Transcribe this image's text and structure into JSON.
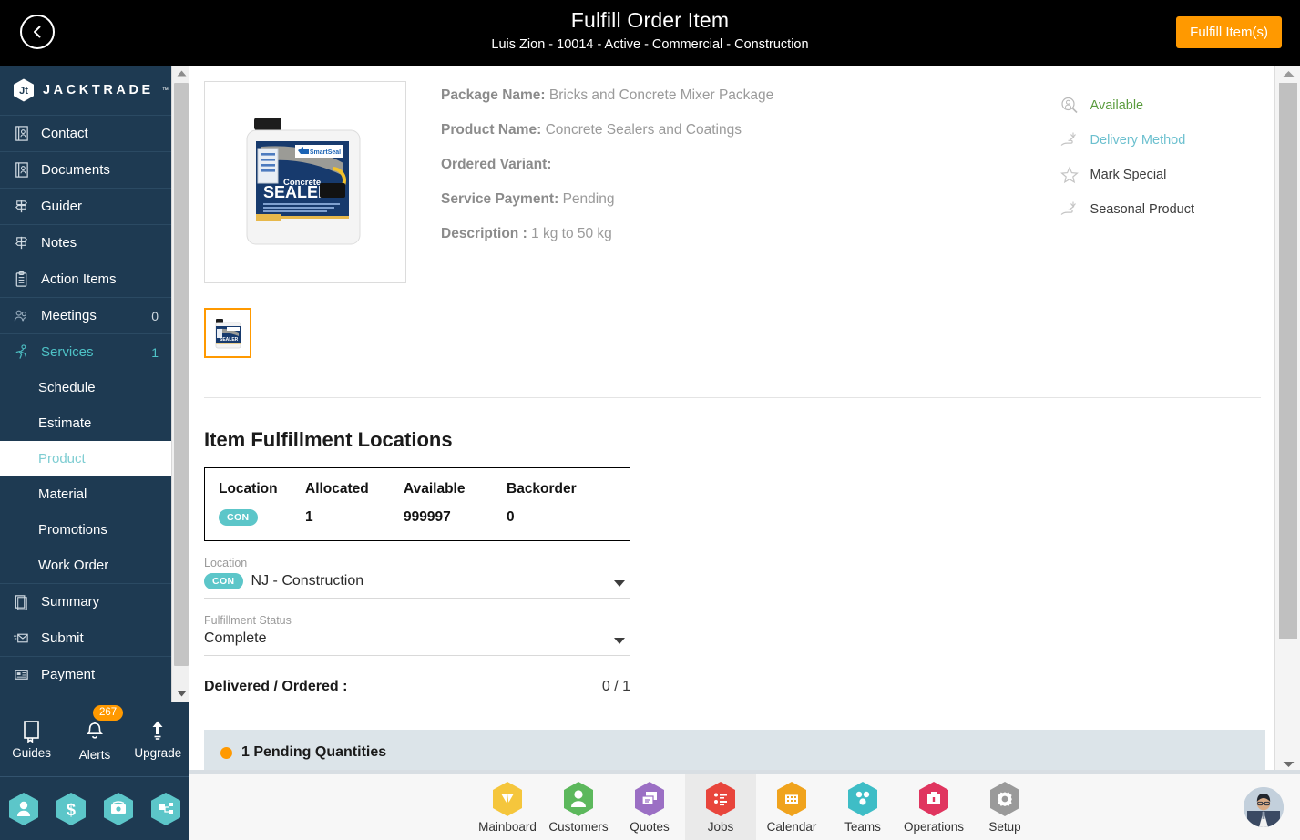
{
  "topbar": {
    "back_icon": "chevron-left-icon",
    "title": "Fulfill Order Item",
    "subtitle": "Luis Zion - 10014 - Active - Commercial - Construction",
    "action_button": "Fulfill Item(s)",
    "accent_color": "#ff9900",
    "background": "#000000"
  },
  "sidebar": {
    "brand": "JACKTRADE",
    "brand_tm": "™",
    "background": "#1e3a52",
    "accent_color": "#4ec3c7",
    "items": [
      {
        "label": "Contact",
        "icon": "contact-book-icon",
        "count": ""
      },
      {
        "label": "Documents",
        "icon": "documents-icon",
        "count": ""
      },
      {
        "label": "Guider",
        "icon": "signpost-icon",
        "count": ""
      },
      {
        "label": "Notes",
        "icon": "signpost-icon",
        "count": ""
      },
      {
        "label": "Action Items",
        "icon": "clipboard-icon",
        "count": ""
      },
      {
        "label": "Meetings",
        "icon": "meetings-icon",
        "count": "0"
      },
      {
        "label": "Services",
        "icon": "services-runner-icon",
        "count": "1"
      }
    ],
    "sub_items": [
      {
        "label": "Schedule",
        "active": false
      },
      {
        "label": "Estimate",
        "active": false
      },
      {
        "label": "Product",
        "active": true
      },
      {
        "label": "Material",
        "active": false
      },
      {
        "label": "Promotions",
        "active": false
      },
      {
        "label": "Work Order",
        "active": false
      }
    ],
    "items_bottom": [
      {
        "label": "Summary",
        "icon": "summary-icon"
      },
      {
        "label": "Submit",
        "icon": "submit-mail-icon"
      },
      {
        "label": "Payment",
        "icon": "payment-card-icon"
      }
    ],
    "footer": {
      "guides": "Guides",
      "guides_icon": "book-icon",
      "alerts": "Alerts",
      "alerts_icon": "bell-icon",
      "alerts_badge": "267",
      "upgrade": "Upgrade",
      "upgrade_icon": "upload-arrow-icon",
      "quick_icons": [
        "person-hex-icon",
        "dollar-hex-icon",
        "money-transfer-hex-icon",
        "workflow-hex-icon"
      ]
    }
  },
  "main": {
    "product_image_alt": "concrete-sealer-jug-image",
    "thumbnail_alt": "concrete-sealer-thumbnail",
    "fields": [
      {
        "label": "Package Name:",
        "value": "Bricks and Concrete Mixer Package"
      },
      {
        "label": "Product Name:",
        "value": "Concrete Sealers and Coatings"
      },
      {
        "label": "Ordered Variant:",
        "value": ""
      },
      {
        "label": "Service Payment:",
        "value": "Pending"
      },
      {
        "label": "Description :",
        "value": "1 kg to 50 kg"
      }
    ],
    "status_flags": [
      {
        "label": "Available",
        "icon": "availability-search-icon",
        "color": "#5b9c3e"
      },
      {
        "label": "Delivery Method",
        "icon": "hand-delivery-icon",
        "color": "#6cc0cf"
      },
      {
        "label": "Mark Special",
        "icon": "star-icon",
        "color": "#3c3c3c"
      },
      {
        "label": "Seasonal Product",
        "icon": "hand-seasonal-icon",
        "color": "#3c3c3c"
      }
    ],
    "section_title": "Item Fulfillment Locations",
    "table": {
      "headers": [
        "Location",
        "Allocated",
        "Available",
        "Backorder"
      ],
      "rows": [
        {
          "location_chip": "CON",
          "allocated": "1",
          "available": "999997",
          "backorder": "0"
        }
      ]
    },
    "location_field": {
      "label": "Location",
      "chip": "CON",
      "value": "NJ - Construction"
    },
    "fulfillment_status_field": {
      "label": "Fulfillment Status",
      "value": "Complete"
    },
    "delivered_ordered": {
      "label": "Delivered / Ordered :",
      "value": "0 / 1"
    },
    "pending_banner": {
      "text": "1 Pending Quantities",
      "dot_color": "#ff9900",
      "background": "#dce4e9"
    }
  },
  "bottomnav": {
    "items": [
      {
        "label": "Mainboard",
        "icon": "mainboard-icon",
        "color": "#f5c63c",
        "active": false
      },
      {
        "label": "Customers",
        "icon": "customers-person-icon",
        "color": "#5cb85c",
        "active": false
      },
      {
        "label": "Quotes",
        "icon": "quotes-icon",
        "color": "#9b6fc4",
        "active": false
      },
      {
        "label": "Jobs",
        "icon": "jobs-list-icon",
        "color": "#e8453c",
        "active": true
      },
      {
        "label": "Calendar",
        "icon": "calendar-icon",
        "color": "#f0a31d",
        "active": false
      },
      {
        "label": "Teams",
        "icon": "teams-icon",
        "color": "#3ebdc6",
        "active": false
      },
      {
        "label": "Operations",
        "icon": "operations-briefcase-icon",
        "color": "#e0355f",
        "active": false
      },
      {
        "label": "Setup",
        "icon": "gear-icon",
        "color": "#9a9a9a",
        "active": false
      }
    ],
    "avatar": "user-avatar"
  }
}
